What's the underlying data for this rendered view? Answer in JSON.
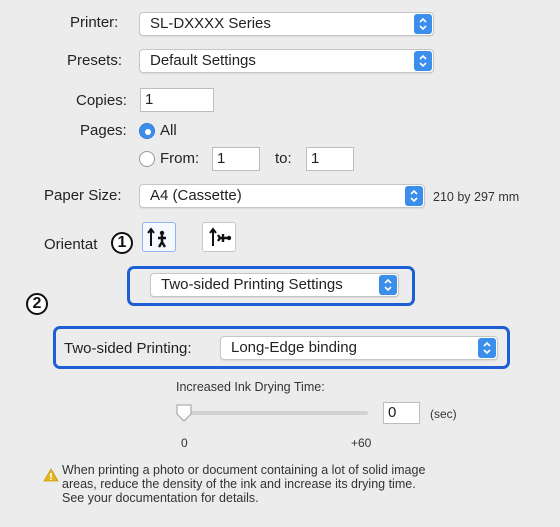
{
  "printer": {
    "label": "Printer:",
    "value": "SL-DXXXX Series"
  },
  "presets": {
    "label": "Presets:",
    "value": "Default Settings"
  },
  "copies": {
    "label": "Copies:",
    "value": "1"
  },
  "pages": {
    "label": "Pages:",
    "all_label": "All",
    "all_selected": true,
    "from_label": "From:",
    "from_value": "1",
    "to_label": "to:",
    "to_value": "1"
  },
  "paper_size": {
    "label": "Paper Size:",
    "value": "A4 (Cassette)",
    "dimensions": "210 by 297 mm"
  },
  "orientation": {
    "label": "Orientat",
    "selected": "portrait"
  },
  "markers": {
    "one": "1",
    "two": "2"
  },
  "section_popup": {
    "value": "Two-sided Printing Settings"
  },
  "two_sided": {
    "label": "Two-sided Printing:",
    "value": "Long-Edge binding"
  },
  "drying": {
    "title": "Increased Ink Drying Time:",
    "value": "0",
    "unit": "(sec)",
    "min_label": "0",
    "max_label": "+60",
    "slider_fraction": 0
  },
  "warning": {
    "line1": "When printing a photo or document containing a lot of solid image",
    "line2": "areas, reduce the density of the ink and increase its drying time.",
    "line3": "See your documentation for details."
  },
  "colors": {
    "accent": "#3b8eea",
    "callout": "#1f5fd6",
    "warning": "#e9b51b"
  }
}
